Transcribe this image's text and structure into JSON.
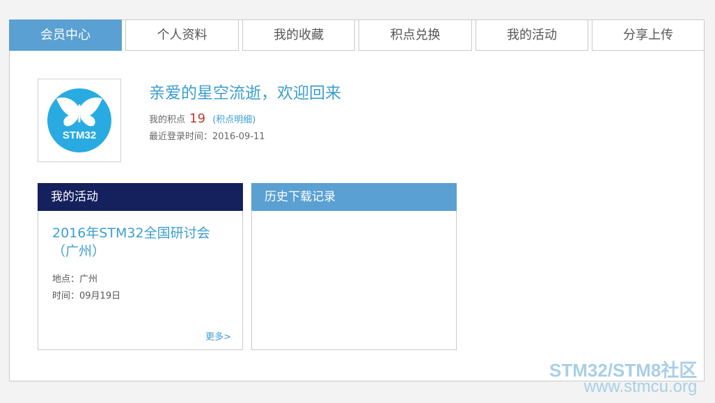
{
  "tabs": [
    {
      "label": "会员中心",
      "active": true
    },
    {
      "label": "个人资料",
      "active": false
    },
    {
      "label": "我的收藏",
      "active": false
    },
    {
      "label": "积点兑换",
      "active": false
    },
    {
      "label": "我的活动",
      "active": false
    },
    {
      "label": "分享上传",
      "active": false
    }
  ],
  "profile": {
    "avatar_text": "STM32",
    "welcome": "亲爱的星空流逝，欢迎回来",
    "points_label": "我的积点",
    "points_value": "19",
    "points_link": "(积点明细)",
    "last_login": "最近登录时间：2016-09-11"
  },
  "activities_panel": {
    "title": "我的活动",
    "event_title": "2016年STM32全国研讨会（广州）",
    "location": "地点：广州",
    "time": "时间：09月19日",
    "more": "更多>"
  },
  "downloads_panel": {
    "title": "历史下载记录"
  },
  "watermark": {
    "line1": "STM32/STM8社区",
    "line2": "www.stmcu.org"
  },
  "colors": {
    "accent": "#5aa0d2",
    "link": "#3b9ed1",
    "dark_header": "#14215c",
    "points": "#c0392b",
    "logo": "#29abe2"
  }
}
